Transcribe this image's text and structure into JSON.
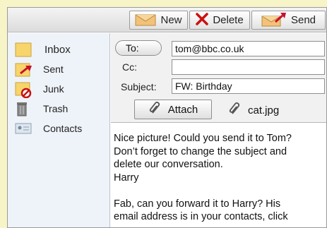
{
  "toolbar": {
    "new_label": "New",
    "delete_label": "Delete",
    "send_label": "Send"
  },
  "sidebar": {
    "items": [
      {
        "label": "Inbox",
        "icon": "folder-icon"
      },
      {
        "label": "Sent",
        "icon": "sent-folder-icon"
      },
      {
        "label": "Junk",
        "icon": "junk-folder-icon"
      },
      {
        "label": "Trash",
        "icon": "trash-icon"
      },
      {
        "label": "Contacts",
        "icon": "contacts-icon"
      }
    ]
  },
  "compose": {
    "to_label": "To:",
    "to_value": "tom@bbc.co.uk",
    "cc_label": "Cc:",
    "cc_value": "",
    "subject_label": "Subject:",
    "subject_value": "FW: Birthday",
    "attach_label": "Attach",
    "attachment_name": "cat.jpg",
    "body": "Nice picture! Could you send it to Tom?\nDon’t forget to change the subject and\ndelete our conversation.\nHarry\n\nFab, can you forward it to Harry? His\nemail address is in your contacts, click"
  },
  "colors": {
    "page_background": "#f7f4c8",
    "sidebar_background": "#eef3f9",
    "delete_red": "#cc1010",
    "send_arrow_red": "#c8102e",
    "folder_yellow": "#f3c94a"
  }
}
